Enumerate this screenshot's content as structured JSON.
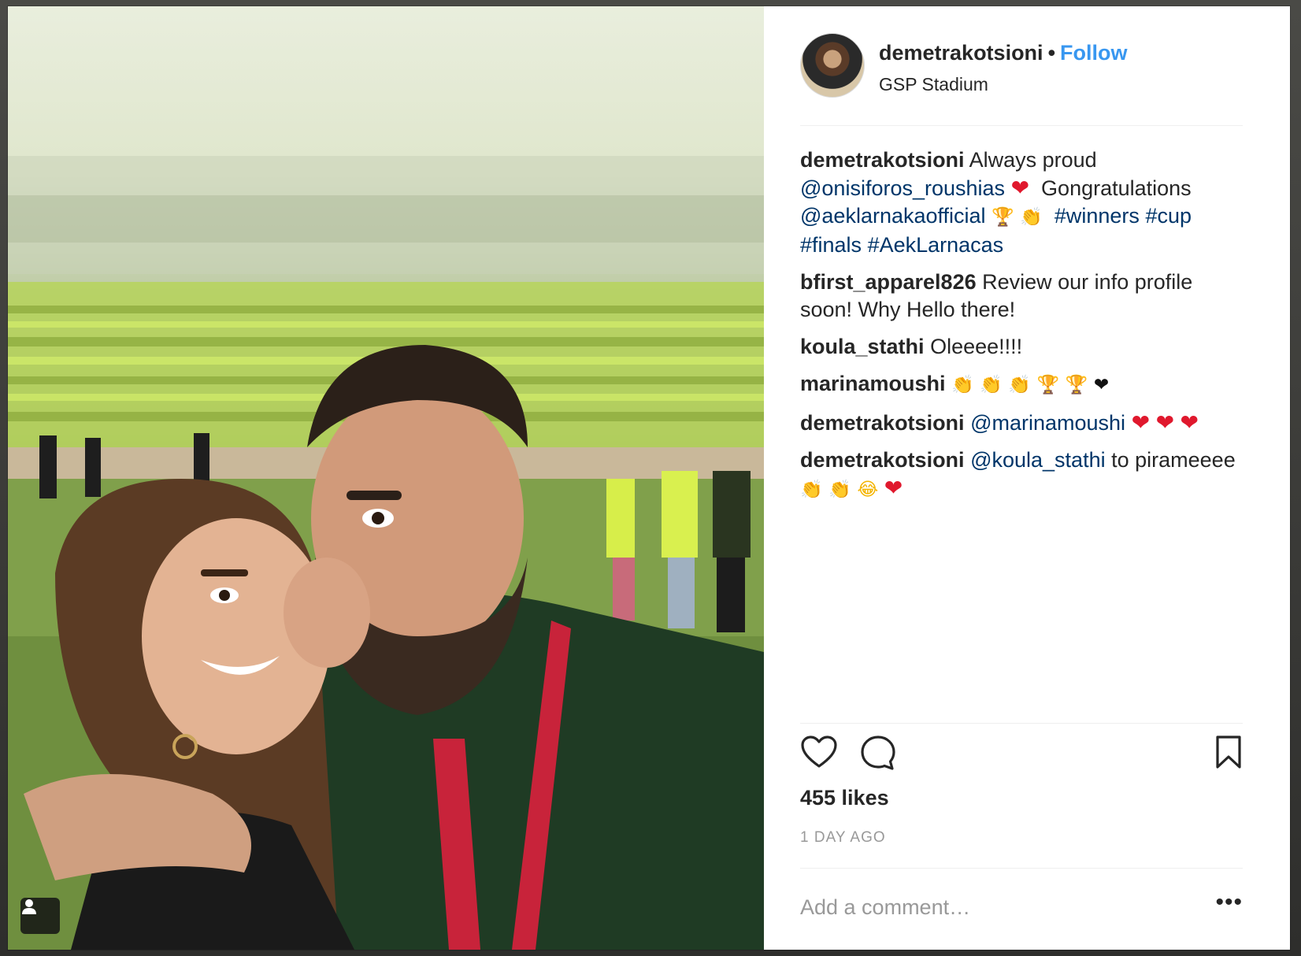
{
  "post": {
    "username": "demetrakotsioni",
    "follow_label": "Follow",
    "separator": "•",
    "location": "GSP Stadium"
  },
  "comments": [
    {
      "user": "demetrakotsioni",
      "text1": "Always proud",
      "mention1": "@onisiforos_roushias",
      "text2": "Gongratulations",
      "mention2": "@aeklarnakaofficial",
      "tags": [
        "#winners",
        "#cup",
        "#finals",
        "#AekLarnacas"
      ]
    },
    {
      "user": "bfirst_apparel826",
      "text": "Review our info profile soon! Why Hello there!"
    },
    {
      "user": "koula_stathi",
      "text": "Oleeee!!!!"
    },
    {
      "user": "marinamoushi"
    },
    {
      "user": "demetrakotsioni",
      "mention": "@marinamoushi"
    },
    {
      "user": "demetrakotsioni",
      "mention": "@koula_stathi",
      "text": "to pirameeee"
    }
  ],
  "emoji": {
    "heart": "❤",
    "trophy": "🏆",
    "clap": "👏",
    "clap_light": "👏",
    "laugh": "😂",
    "black_heart": "❤"
  },
  "stats": {
    "likes": "455 likes",
    "time": "1 DAY AGO"
  },
  "composer": {
    "placeholder": "Add a comment…",
    "more_label": "•••"
  },
  "icons": {
    "like": "heart-outline-icon",
    "comment": "speech-bubble-icon",
    "save": "bookmark-icon",
    "user_tag": "person-icon"
  },
  "colors": {
    "link_blue": "#003569",
    "follow_blue": "#3897f0",
    "text": "#262626",
    "muted": "#999999"
  }
}
